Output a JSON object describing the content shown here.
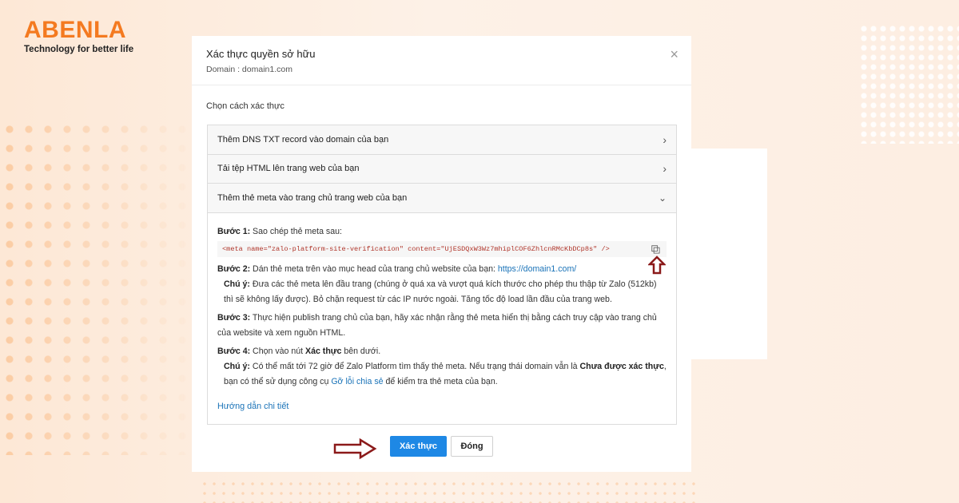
{
  "brand": {
    "name": "ABENLA",
    "tagline": "Technology for better life",
    "color": "#f47a20"
  },
  "dialog": {
    "title": "Xác thực quyền sở hữu",
    "subtitle": "Domain : domain1.com",
    "close_icon": "×",
    "section_label": "Chọn cách xác thực",
    "options": [
      {
        "label": "Thêm DNS TXT record vào domain của bạn",
        "icon": "chevron-right-icon",
        "glyph": "›"
      },
      {
        "label": "Tải tệp HTML lên trang web của bạn",
        "icon": "chevron-right-icon",
        "glyph": "›"
      },
      {
        "label": "Thêm thẻ meta vào trang chủ trang web của bạn",
        "icon": "chevron-down-icon",
        "glyph": "⌄"
      }
    ],
    "steps": {
      "step1_label": "Bước 1:",
      "step1_text": " Sao chép thẻ meta sau:",
      "meta_code": "<meta name=\"zalo-platform-site-verification\" content=\"UjESDQxW3Wz7mhiplCOF6ZhlcnRMcKbDCp8s\" />",
      "step2_label": "Bước 2:",
      "step2_text": " Dán thẻ meta trên vào mục head của trang chủ website của bạn: ",
      "step2_link": "https://domain1.com/",
      "note_label": "Chú ý:",
      "step2_note": " Đưa các thẻ meta lên đầu trang (chúng ở quá xa và vượt quá kích thước cho phép thu thập từ Zalo (512kb) thì sẽ không lấy được). Bỏ chặn request từ các IP nước ngoài. Tăng tốc độ load lần đầu của trang web.",
      "step3_label": "Bước 3:",
      "step3_text": " Thực hiện publish trang chủ của bạn, hãy xác nhận rằng thẻ meta hiển thị bằng cách truy cập vào trang chủ của website và xem nguồn HTML.",
      "step4_label": "Bước 4:",
      "step4_text_a": " Chọn vào nút ",
      "step4_bold": "Xác thực",
      "step4_text_b": " bên dưới.",
      "step4_note_a": " Có thể mất tới 72 giờ để Zalo Platform tìm thấy thẻ meta. Nếu trạng thái domain vẫn là ",
      "step4_note_bold": "Chưa được xác thực",
      "step4_note_b": ", bạn có thể sử dụng công cụ ",
      "step4_note_link": "Gỡ lỗi chia sẻ",
      "step4_note_c": " để kiểm tra thẻ meta của bạn."
    },
    "guide_link": "Hướng dẫn chi tiết",
    "buttons": {
      "verify": "Xác thực",
      "close": "Đóng"
    }
  },
  "colors": {
    "primary_button": "#1e88e5",
    "link": "#1a73b8",
    "code_text": "#b0362b",
    "annotation_arrow": "#8b1a1a"
  }
}
